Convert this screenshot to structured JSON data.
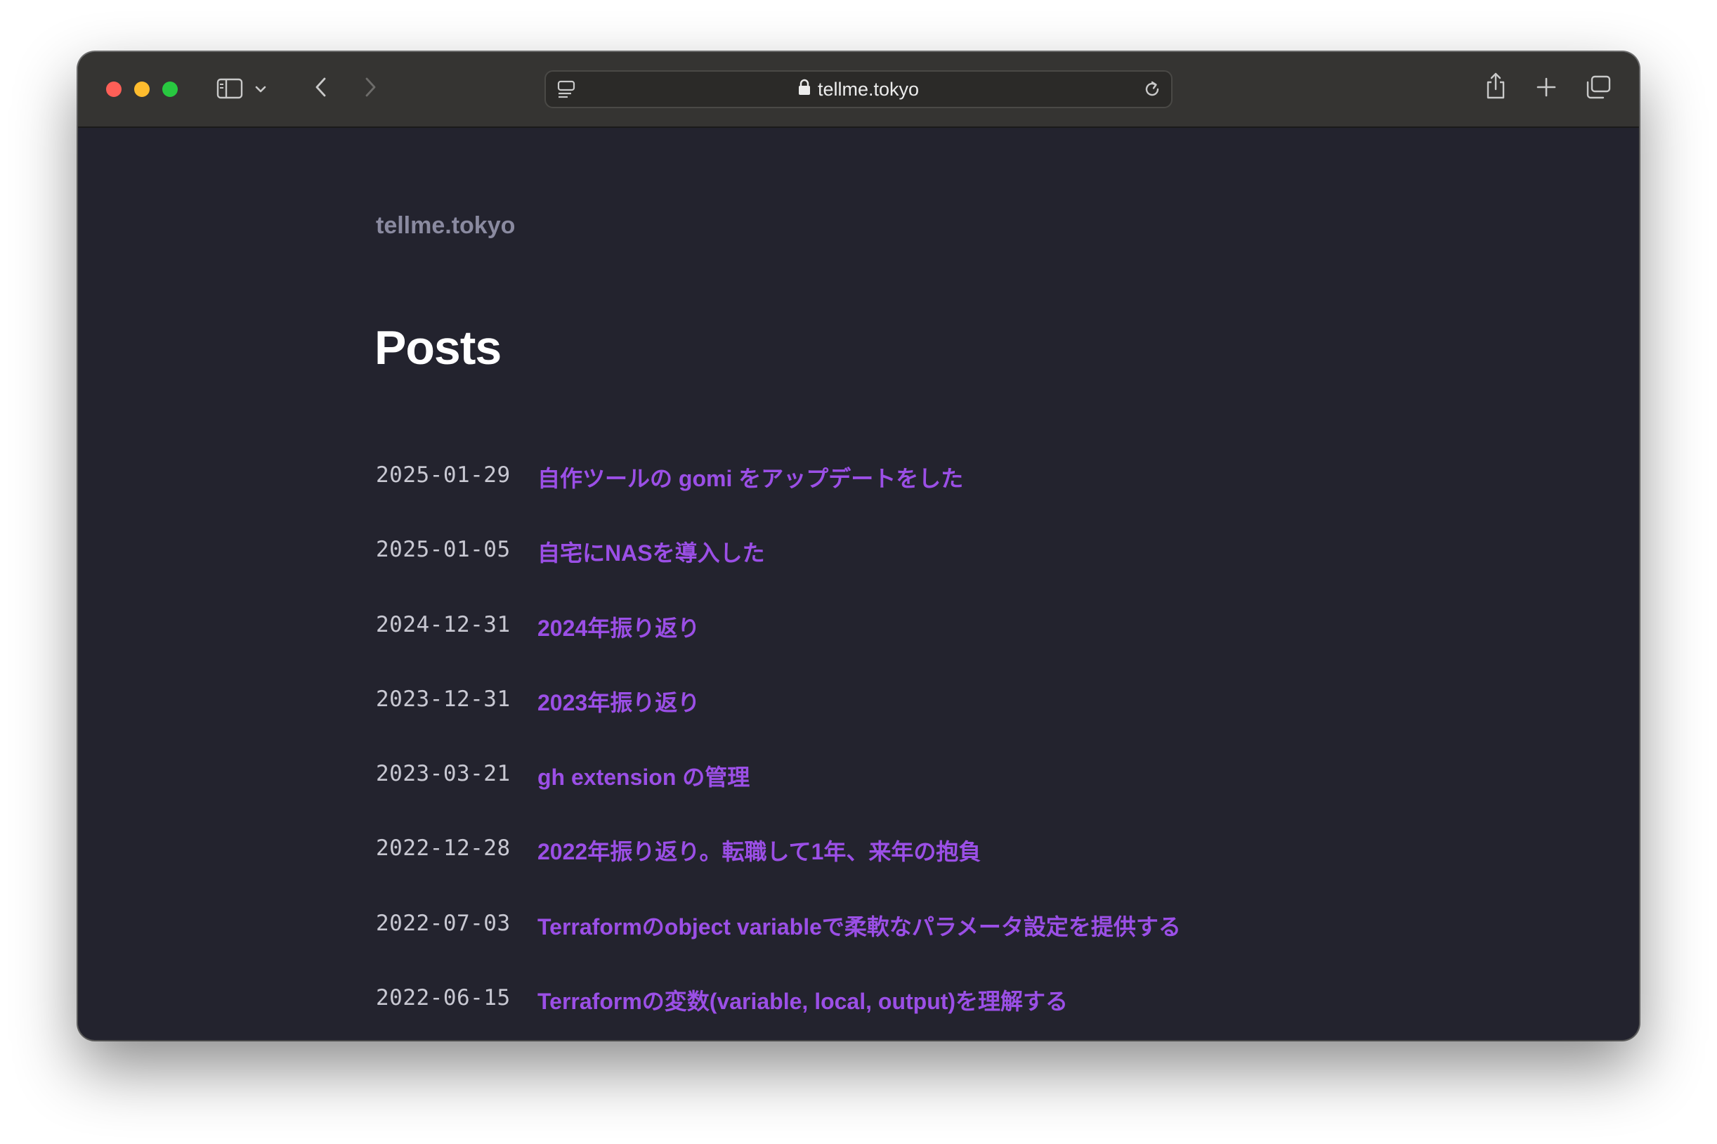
{
  "browser": {
    "url": "tellme.tokyo"
  },
  "site": {
    "title": "tellme.tokyo"
  },
  "page": {
    "heading": "Posts"
  },
  "posts": [
    {
      "date": "2025-01-29",
      "title": "自作ツールの gomi をアップデートをした"
    },
    {
      "date": "2025-01-05",
      "title": "自宅にNASを導入した"
    },
    {
      "date": "2024-12-31",
      "title": "2024年振り返り"
    },
    {
      "date": "2023-12-31",
      "title": "2023年振り返り"
    },
    {
      "date": "2023-03-21",
      "title": "gh extension の管理"
    },
    {
      "date": "2022-12-28",
      "title": "2022年振り返り。転職して1年、来年の抱負"
    },
    {
      "date": "2022-07-03",
      "title": "Terraformのobject variableで柔軟なパラメータ設定を提供する"
    },
    {
      "date": "2022-06-15",
      "title": "Terraformの変数(variable, local, output)を理解する"
    }
  ],
  "colors": {
    "page_background": "#23232e",
    "link": "#9b4fe6",
    "site_title": "#8a8aa0",
    "toolbar": "#353432"
  },
  "icons": {
    "sidebar": "sidebar-icon",
    "tab_group": "chevron-down-icon",
    "back": "chevron-left-icon",
    "forward": "chevron-right-icon",
    "reader": "page-menu-icon",
    "lock": "lock-icon",
    "reload": "reload-icon",
    "share": "share-icon",
    "new_tab": "plus-icon",
    "tabs": "tab-overview-icon"
  }
}
